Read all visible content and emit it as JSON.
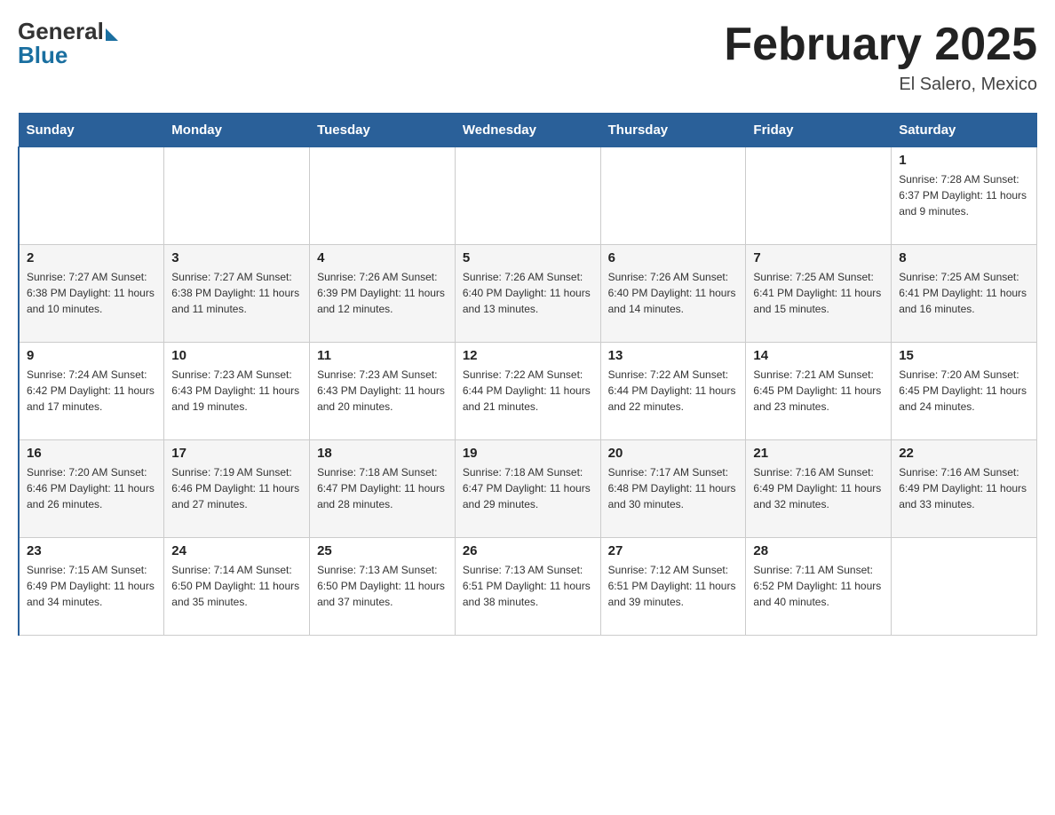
{
  "header": {
    "logo_general": "General",
    "logo_blue": "Blue",
    "month_title": "February 2025",
    "location": "El Salero, Mexico"
  },
  "days_of_week": [
    "Sunday",
    "Monday",
    "Tuesday",
    "Wednesday",
    "Thursday",
    "Friday",
    "Saturday"
  ],
  "weeks": [
    [
      {
        "day": "",
        "info": ""
      },
      {
        "day": "",
        "info": ""
      },
      {
        "day": "",
        "info": ""
      },
      {
        "day": "",
        "info": ""
      },
      {
        "day": "",
        "info": ""
      },
      {
        "day": "",
        "info": ""
      },
      {
        "day": "1",
        "info": "Sunrise: 7:28 AM\nSunset: 6:37 PM\nDaylight: 11 hours and 9 minutes."
      }
    ],
    [
      {
        "day": "2",
        "info": "Sunrise: 7:27 AM\nSunset: 6:38 PM\nDaylight: 11 hours and 10 minutes."
      },
      {
        "day": "3",
        "info": "Sunrise: 7:27 AM\nSunset: 6:38 PM\nDaylight: 11 hours and 11 minutes."
      },
      {
        "day": "4",
        "info": "Sunrise: 7:26 AM\nSunset: 6:39 PM\nDaylight: 11 hours and 12 minutes."
      },
      {
        "day": "5",
        "info": "Sunrise: 7:26 AM\nSunset: 6:40 PM\nDaylight: 11 hours and 13 minutes."
      },
      {
        "day": "6",
        "info": "Sunrise: 7:26 AM\nSunset: 6:40 PM\nDaylight: 11 hours and 14 minutes."
      },
      {
        "day": "7",
        "info": "Sunrise: 7:25 AM\nSunset: 6:41 PM\nDaylight: 11 hours and 15 minutes."
      },
      {
        "day": "8",
        "info": "Sunrise: 7:25 AM\nSunset: 6:41 PM\nDaylight: 11 hours and 16 minutes."
      }
    ],
    [
      {
        "day": "9",
        "info": "Sunrise: 7:24 AM\nSunset: 6:42 PM\nDaylight: 11 hours and 17 minutes."
      },
      {
        "day": "10",
        "info": "Sunrise: 7:23 AM\nSunset: 6:43 PM\nDaylight: 11 hours and 19 minutes."
      },
      {
        "day": "11",
        "info": "Sunrise: 7:23 AM\nSunset: 6:43 PM\nDaylight: 11 hours and 20 minutes."
      },
      {
        "day": "12",
        "info": "Sunrise: 7:22 AM\nSunset: 6:44 PM\nDaylight: 11 hours and 21 minutes."
      },
      {
        "day": "13",
        "info": "Sunrise: 7:22 AM\nSunset: 6:44 PM\nDaylight: 11 hours and 22 minutes."
      },
      {
        "day": "14",
        "info": "Sunrise: 7:21 AM\nSunset: 6:45 PM\nDaylight: 11 hours and 23 minutes."
      },
      {
        "day": "15",
        "info": "Sunrise: 7:20 AM\nSunset: 6:45 PM\nDaylight: 11 hours and 24 minutes."
      }
    ],
    [
      {
        "day": "16",
        "info": "Sunrise: 7:20 AM\nSunset: 6:46 PM\nDaylight: 11 hours and 26 minutes."
      },
      {
        "day": "17",
        "info": "Sunrise: 7:19 AM\nSunset: 6:46 PM\nDaylight: 11 hours and 27 minutes."
      },
      {
        "day": "18",
        "info": "Sunrise: 7:18 AM\nSunset: 6:47 PM\nDaylight: 11 hours and 28 minutes."
      },
      {
        "day": "19",
        "info": "Sunrise: 7:18 AM\nSunset: 6:47 PM\nDaylight: 11 hours and 29 minutes."
      },
      {
        "day": "20",
        "info": "Sunrise: 7:17 AM\nSunset: 6:48 PM\nDaylight: 11 hours and 30 minutes."
      },
      {
        "day": "21",
        "info": "Sunrise: 7:16 AM\nSunset: 6:49 PM\nDaylight: 11 hours and 32 minutes."
      },
      {
        "day": "22",
        "info": "Sunrise: 7:16 AM\nSunset: 6:49 PM\nDaylight: 11 hours and 33 minutes."
      }
    ],
    [
      {
        "day": "23",
        "info": "Sunrise: 7:15 AM\nSunset: 6:49 PM\nDaylight: 11 hours and 34 minutes."
      },
      {
        "day": "24",
        "info": "Sunrise: 7:14 AM\nSunset: 6:50 PM\nDaylight: 11 hours and 35 minutes."
      },
      {
        "day": "25",
        "info": "Sunrise: 7:13 AM\nSunset: 6:50 PM\nDaylight: 11 hours and 37 minutes."
      },
      {
        "day": "26",
        "info": "Sunrise: 7:13 AM\nSunset: 6:51 PM\nDaylight: 11 hours and 38 minutes."
      },
      {
        "day": "27",
        "info": "Sunrise: 7:12 AM\nSunset: 6:51 PM\nDaylight: 11 hours and 39 minutes."
      },
      {
        "day": "28",
        "info": "Sunrise: 7:11 AM\nSunset: 6:52 PM\nDaylight: 11 hours and 40 minutes."
      },
      {
        "day": "",
        "info": ""
      }
    ]
  ]
}
